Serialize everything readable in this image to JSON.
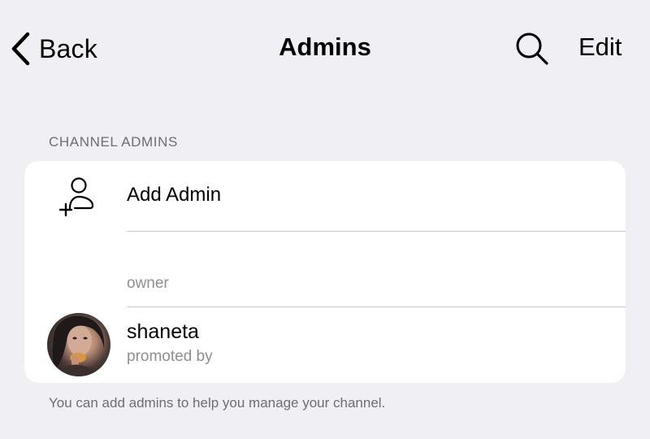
{
  "nav": {
    "back_label": "Back",
    "title": "Admins",
    "edit_label": "Edit",
    "search_icon": "search-icon"
  },
  "section": {
    "header": "CHANNEL ADMINS",
    "add_admin_label": "Add Admin",
    "add_admin_icon": "add-person-icon",
    "owner_label": "owner",
    "admins": [
      {
        "name": "shaneta",
        "subtitle": "promoted by"
      }
    ],
    "footer": "You can add admins to help you manage your channel."
  },
  "colors": {
    "background": "#efeff4",
    "card": "#ffffff",
    "secondary_text": "#8e8e93",
    "header_text": "#6d6d72",
    "separator": "#c8c7cc"
  }
}
